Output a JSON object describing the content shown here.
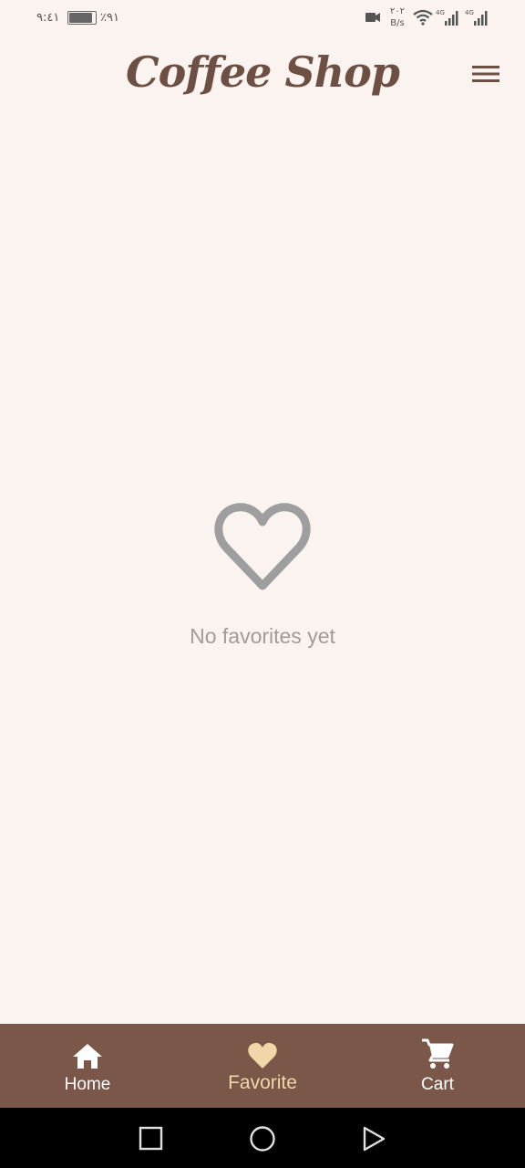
{
  "status_bar": {
    "time": "٩:٤١",
    "battery": "٪٩١",
    "battery_level": 0.91,
    "net_speed_value": "٢٠٢",
    "net_speed_unit": "B/s",
    "network_1": "4G",
    "network_2": "4G"
  },
  "header": {
    "title": "Coffee Shop",
    "menu_icon": "hamburger-menu-icon"
  },
  "empty_state": {
    "icon": "heart-outline-icon",
    "message": "No favorites yet"
  },
  "bottom_nav": {
    "items": [
      {
        "label": "Home",
        "icon": "home-icon",
        "active": false
      },
      {
        "label": "Favorite",
        "icon": "heart-icon",
        "active": true
      },
      {
        "label": "Cart",
        "icon": "cart-icon",
        "active": false
      }
    ]
  },
  "colors": {
    "background": "#fbf3ef",
    "title": "#6e4f44",
    "nav_bar": "#7a5748",
    "nav_active": "#f0d6a8",
    "muted_text": "#a29b98"
  }
}
